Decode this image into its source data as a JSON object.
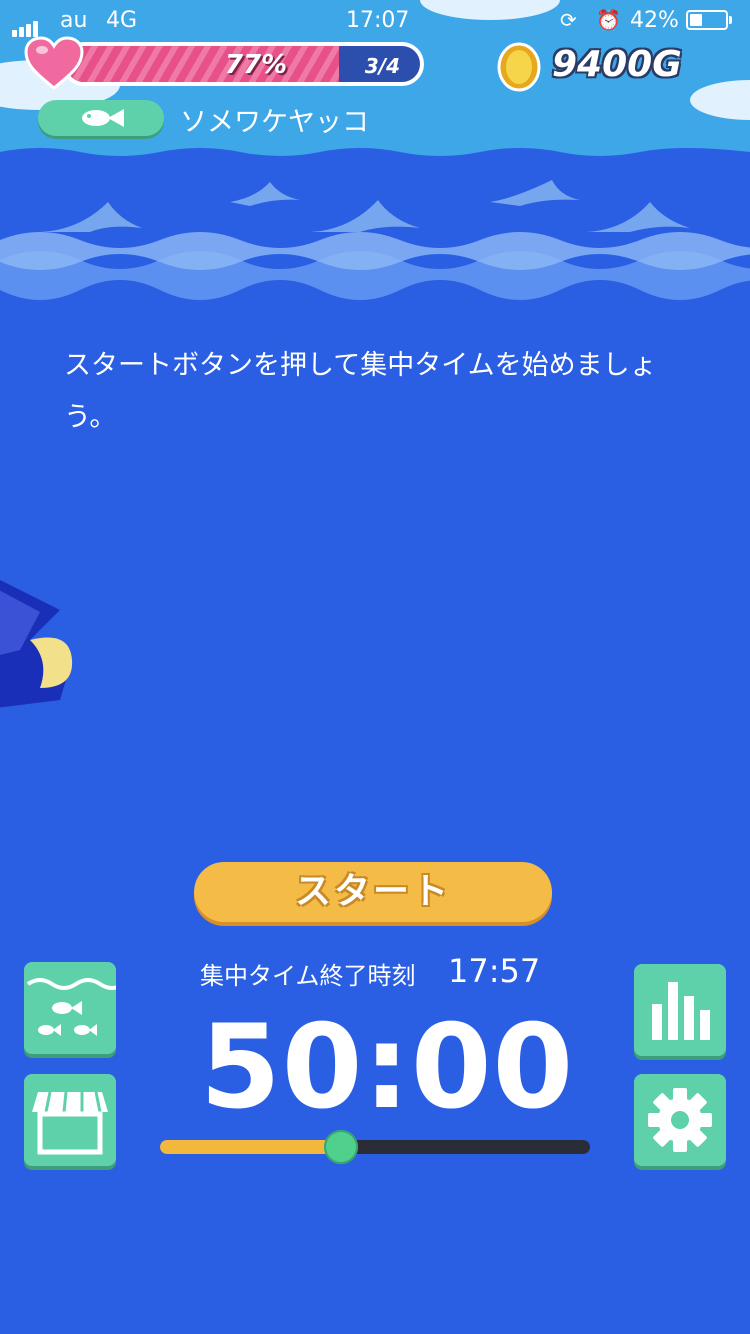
{
  "status": {
    "carrier": "au",
    "network": "4G",
    "time": "17:07",
    "battery_percent": "42%",
    "battery_level": 0.42
  },
  "hp": {
    "percent_label": "77%",
    "fill_fraction": 0.77,
    "count_label": "3/4"
  },
  "currency": {
    "gold": "9400G"
  },
  "fish": {
    "name": "ソメワケヤッコ"
  },
  "main": {
    "instruction": "スタートボタンを押して集中タイムを始めましょう。",
    "start_label": "スタート",
    "end_label": "集中タイム終了時刻",
    "end_time": "17:57",
    "timer": "50:00",
    "slider_fraction": 0.42
  },
  "icons": {
    "aquarium": "aquarium-icon",
    "shop": "shop-icon",
    "stats": "bar-chart-icon",
    "settings": "gear-icon"
  },
  "colors": {
    "sea": "#2a5ee3",
    "sky": "#3da7e8",
    "mint": "#5fd1aa",
    "accent_yellow": "#f5bb47",
    "heart_pink": "#e8508c"
  }
}
